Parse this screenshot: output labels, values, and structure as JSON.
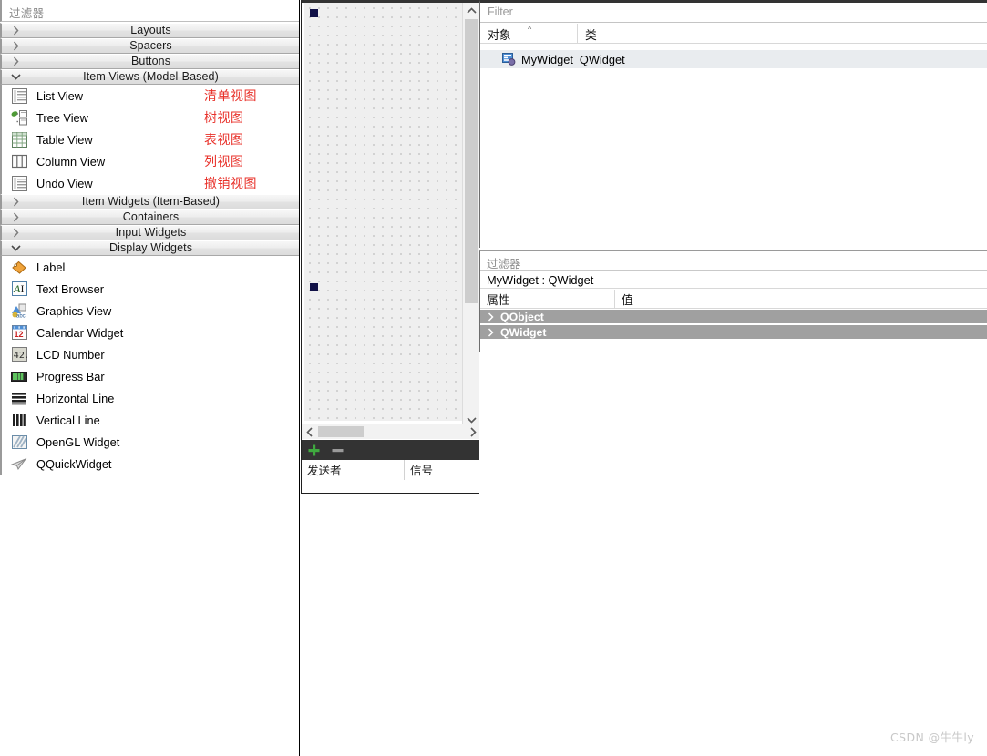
{
  "widget_box": {
    "filter_placeholder": "过滤器",
    "categories": [
      {
        "label": "Layouts",
        "expanded": false,
        "items": []
      },
      {
        "label": "Spacers",
        "expanded": false,
        "items": []
      },
      {
        "label": "Buttons",
        "expanded": false,
        "items": []
      },
      {
        "label": "Item Views (Model-Based)",
        "expanded": true,
        "items": [
          {
            "name": "List View",
            "icon": "list-view-icon",
            "note": "清单视图"
          },
          {
            "name": "Tree View",
            "icon": "tree-view-icon",
            "note": "树视图"
          },
          {
            "name": "Table View",
            "icon": "table-view-icon",
            "note": "表视图"
          },
          {
            "name": "Column View",
            "icon": "column-view-icon",
            "note": "列视图"
          },
          {
            "name": "Undo View",
            "icon": "undo-view-icon",
            "note": "撤销视图"
          }
        ]
      },
      {
        "label": "Item Widgets (Item-Based)",
        "expanded": false,
        "items": []
      },
      {
        "label": "Containers",
        "expanded": false,
        "items": []
      },
      {
        "label": "Input Widgets",
        "expanded": false,
        "items": []
      },
      {
        "label": "Display Widgets",
        "expanded": true,
        "items": [
          {
            "name": "Label",
            "icon": "label-icon",
            "note": ""
          },
          {
            "name": "Text Browser",
            "icon": "text-browser-icon",
            "note": ""
          },
          {
            "name": "Graphics View",
            "icon": "graphics-view-icon",
            "note": ""
          },
          {
            "name": "Calendar Widget",
            "icon": "calendar-icon",
            "note": ""
          },
          {
            "name": "LCD Number",
            "icon": "lcd-number-icon",
            "note": ""
          },
          {
            "name": "Progress Bar",
            "icon": "progress-bar-icon",
            "note": ""
          },
          {
            "name": "Horizontal Line",
            "icon": "horizontal-line-icon",
            "note": ""
          },
          {
            "name": "Vertical Line",
            "icon": "vertical-line-icon",
            "note": ""
          },
          {
            "name": "OpenGL Widget",
            "icon": "opengl-icon",
            "note": ""
          },
          {
            "name": "QQuickWidget",
            "icon": "qquickwidget-icon",
            "note": ""
          }
        ]
      }
    ]
  },
  "form_editor": {
    "zoom_grid_spacing": 10
  },
  "signal_slot_editor": {
    "add_label": "+",
    "remove_label": "−",
    "columns": [
      "发送者",
      "信号"
    ]
  },
  "object_inspector": {
    "filter_placeholder": "Filter",
    "columns": [
      "对象",
      "类"
    ],
    "sort_indicator": "^",
    "rows": [
      {
        "object": "MyWidget",
        "class": "QWidget"
      }
    ]
  },
  "property_editor": {
    "filter_placeholder": "过滤器",
    "target": "MyWidget : QWidget",
    "columns": [
      "属性",
      "值"
    ],
    "groups": [
      {
        "name": "QObject",
        "expanded": false
      },
      {
        "name": "QWidget",
        "expanded": false
      }
    ]
  },
  "watermark": "CSDN @牛牛ly",
  "colors": {
    "annotation_red": "#e8312a",
    "group_row_gray": "#a0a0a0",
    "selection_handle": "#101046",
    "toolbar_dark": "#333333",
    "add_green": "#3fa93f"
  }
}
